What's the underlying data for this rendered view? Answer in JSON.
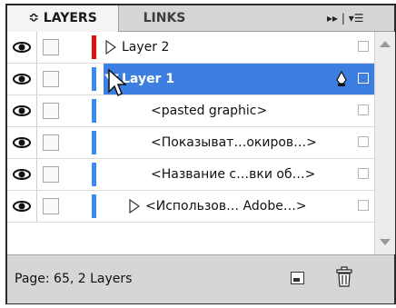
{
  "tabs": {
    "layers": "≎ LAYERS",
    "links": "LINKS",
    "controls": "▸▸ | ▾☰"
  },
  "colors": {
    "red": "#e01010",
    "blue": "#3a8af0",
    "selection": "#3d7fe0"
  },
  "rows": [
    {
      "name": "Layer 2",
      "has_triangle": true,
      "expanded": false,
      "color": "#e01010",
      "selected": false
    },
    {
      "name": "Layer 1",
      "has_triangle": true,
      "expanded": true,
      "color": "#3a8af0",
      "selected": true
    },
    {
      "name": "<pasted graphic>",
      "has_triangle": false,
      "color": "#3a8af0",
      "selected": false
    },
    {
      "name": "<Показыват…окиров…>",
      "has_triangle": false,
      "color": "#3a8af0",
      "selected": false
    },
    {
      "name": "<Название с…вки об…>",
      "has_triangle": false,
      "color": "#3a8af0",
      "selected": false
    },
    {
      "name": "<Использов… Adobe…>",
      "has_triangle": true,
      "expanded": false,
      "color": "#3a8af0",
      "selected": false
    }
  ],
  "status": {
    "text": "Page: 65, 2 Layers"
  }
}
